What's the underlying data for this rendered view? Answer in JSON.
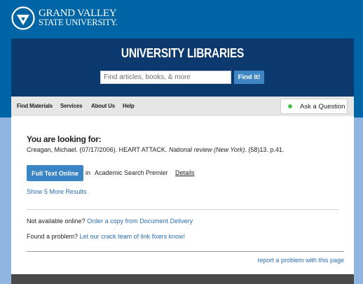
{
  "brand": {
    "line1": "GRAND VALLEY",
    "line2": "STATE UNIVERSITY."
  },
  "header": {
    "title": "UNIVERSITY LIBRARIES",
    "search_placeholder": "Find articles, books, & more",
    "search_button": "Find It!"
  },
  "nav": {
    "items": [
      {
        "label": "Find Materials"
      },
      {
        "label": "Services"
      },
      {
        "label": "About Us"
      },
      {
        "label": "Help"
      }
    ],
    "ask_label": "Ask a Question"
  },
  "result": {
    "heading": "You are looking for:",
    "citation_prefix": "Creagan, Michael. (07/17/2006). HEART ATTACK.",
    "citation_journal": "National review (New York).",
    "citation_suffix": "(58)13. p.41.",
    "fulltext_button": "Full Text Online",
    "in_word": "in",
    "database": "Academic Search Premier",
    "details_link": "Details",
    "show_more": "Show 5 More Results"
  },
  "help": {
    "not_available_text": "Not available online?",
    "order_link": "Order a copy from Document Delivery",
    "problem_text": "Found a problem?",
    "fixers_link": "Let our crack team of link fixers know!",
    "report_link": "report a problem with this page"
  },
  "colors": {
    "top_band": "#0065a4",
    "dark_header": "#0d3a6e",
    "background": "#8fb6e0",
    "accent_button": "#3a85c6",
    "link": "#2a6db4",
    "status_dot": "#4cc14c"
  },
  "icons": {
    "logo": "gvsu-logo-icon",
    "status": "online-status-dot-icon"
  }
}
